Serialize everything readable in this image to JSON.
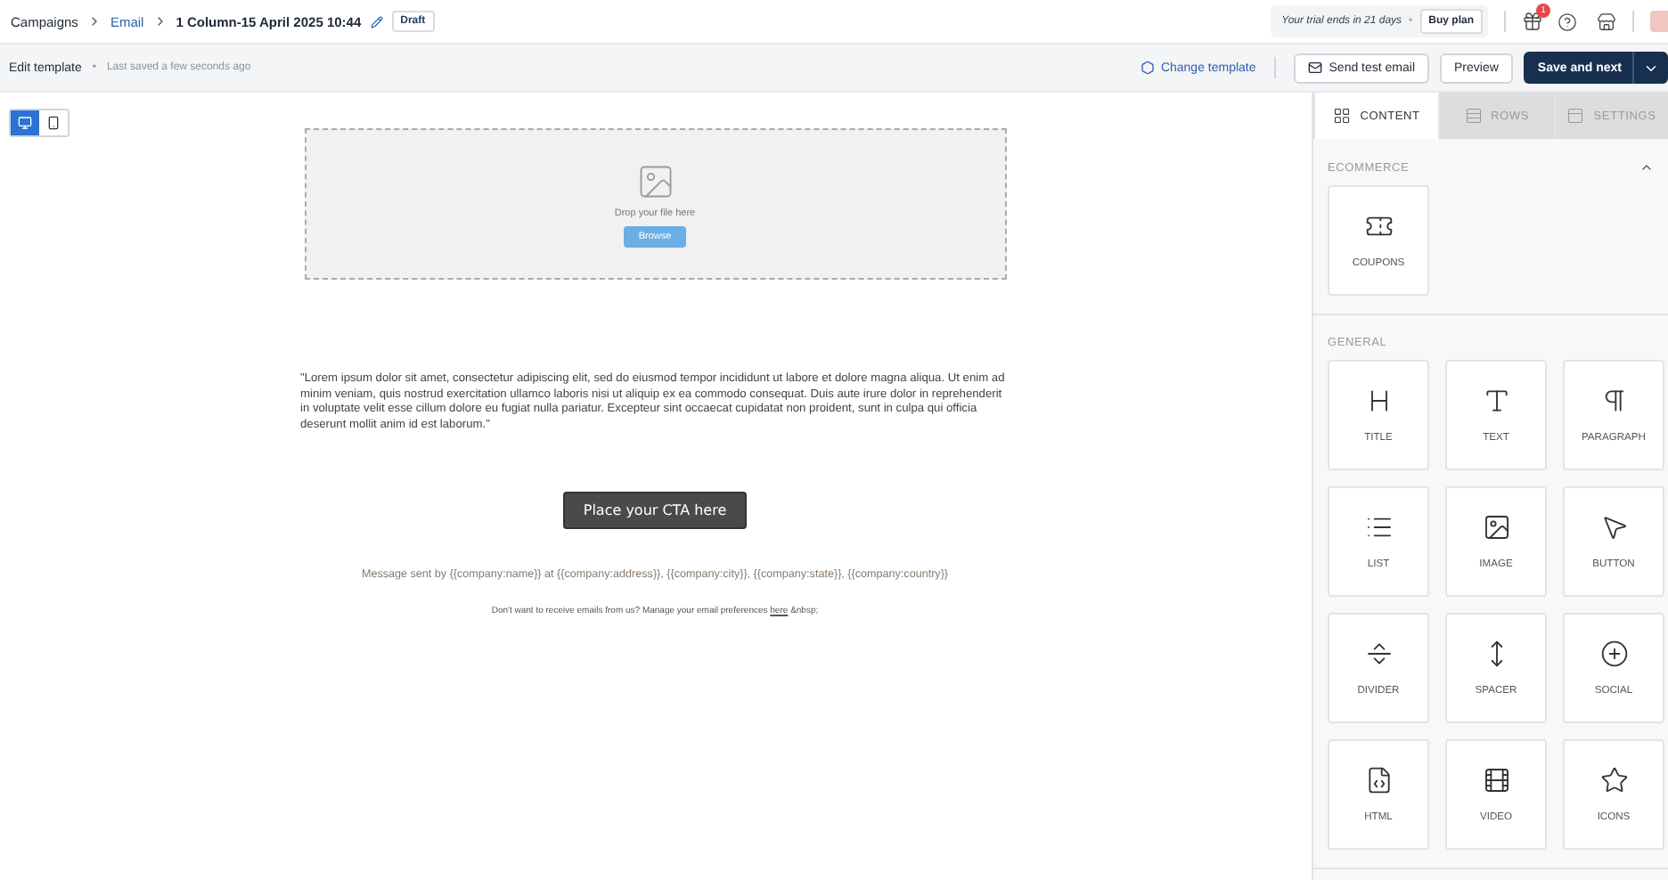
{
  "breadcrumbs": [
    {
      "label": "Campaigns",
      "kind": "plain"
    },
    {
      "label": "Email",
      "kind": "link"
    },
    {
      "label": "1 Column-15 April 2025 10:44",
      "kind": "current"
    }
  ],
  "status_badge": "Draft",
  "trial": {
    "text": "Your trial ends in 21 days",
    "separator": "•",
    "button": "Buy plan"
  },
  "notifications": "1",
  "subbar": {
    "title": "Edit template",
    "separator": "•",
    "saved": "Last saved a few seconds ago",
    "change_template": "Change template",
    "send_test": "Send test email",
    "preview": "Preview",
    "save": "Save and next"
  },
  "devices": [
    {
      "kind": "desktop",
      "selected": true
    },
    {
      "kind": "mobile",
      "selected": false
    }
  ],
  "email": {
    "drop_text": "Drop your file here",
    "browse": "Browse",
    "body": "\"Lorem ipsum dolor sit amet, consectetur adipiscing elit, sed do eiusmod tempor incididunt ut labore et dolore magna aliqua. Ut enim ad minim veniam, quis nostrud exercitation ullamco laboris nisi ut aliquip ex ea commodo consequat. Duis aute irure dolor in reprehenderit in voluptate velit esse cillum dolore eu fugiat nulla pariatur. Excepteur sint occaecat cupidatat non proident, sunt in culpa qui officia deserunt mollit anim id est laborum.\"",
    "cta": "Place your CTA here",
    "footer": "Message sent by {{company:name}} at {{company:address}}, {{company:city}}, {{company:state}}, {{company:country}}",
    "unsubscribe_before": "Don't want to receive emails from us? Manage your email preferences",
    "unsubscribe_link": "here",
    "unsubscribe_after": "&nbsp;"
  },
  "tabs": [
    {
      "label": "CONTENT",
      "kind": "grid",
      "selected": true
    },
    {
      "label": "ROWS",
      "kind": "rows",
      "selected": false
    },
    {
      "label": "SETTINGS",
      "kind": "settings",
      "selected": false
    }
  ],
  "sections": [
    {
      "title": "ECOMMERCE",
      "expanded": true,
      "tiles": [
        {
          "label": "COUPONS",
          "kind": "coupon"
        }
      ]
    },
    {
      "title": "GENERAL",
      "tiles": [
        {
          "label": "TITLE",
          "kind": "title"
        },
        {
          "label": "TEXT",
          "kind": "text"
        },
        {
          "label": "PARAGRAPH",
          "kind": "paragraph"
        },
        {
          "label": "LIST",
          "kind": "list"
        },
        {
          "label": "IMAGE",
          "kind": "image"
        },
        {
          "label": "BUTTON",
          "kind": "button"
        },
        {
          "label": "DIVIDER",
          "kind": "divider"
        },
        {
          "label": "SPACER",
          "kind": "spacer"
        },
        {
          "label": "SOCIAL",
          "kind": "social"
        },
        {
          "label": "HTML",
          "kind": "html"
        },
        {
          "label": "VIDEO",
          "kind": "video"
        },
        {
          "label": "ICONS",
          "kind": "icons"
        }
      ]
    }
  ]
}
